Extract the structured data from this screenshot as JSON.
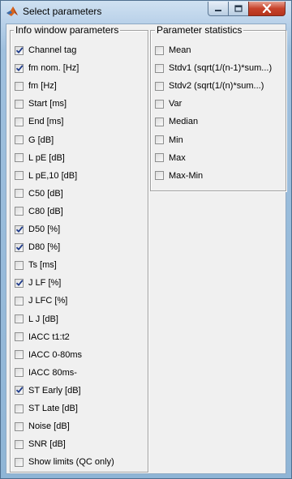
{
  "window": {
    "title": "Select parameters",
    "accent_close": "#c7432b"
  },
  "icons": {
    "app": "matlab-logo-icon",
    "minimize": "minimize-icon",
    "maximize": "maximize-icon",
    "close": "close-icon"
  },
  "info_panel": {
    "legend": "Info window parameters",
    "items": [
      {
        "label": "Channel tag",
        "checked": true
      },
      {
        "label": "fm nom. [Hz]",
        "checked": true
      },
      {
        "label": "fm [Hz]",
        "checked": false
      },
      {
        "label": "Start [ms]",
        "checked": false
      },
      {
        "label": "End [ms]",
        "checked": false
      },
      {
        "label": "G [dB]",
        "checked": false
      },
      {
        "label": "L pE [dB]",
        "checked": false
      },
      {
        "label": "L pE,10 [dB]",
        "checked": false
      },
      {
        "label": "C50 [dB]",
        "checked": false
      },
      {
        "label": "C80 [dB]",
        "checked": false
      },
      {
        "label": "D50 [%]",
        "checked": true
      },
      {
        "label": "D80 [%]",
        "checked": true
      },
      {
        "label": "Ts [ms]",
        "checked": false
      },
      {
        "label": "J LF [%]",
        "checked": true
      },
      {
        "label": "J LFC [%]",
        "checked": false
      },
      {
        "label": "L J [dB]",
        "checked": false
      },
      {
        "label": "IACC t1:t2",
        "checked": false
      },
      {
        "label": "IACC 0-80ms",
        "checked": false
      },
      {
        "label": "IACC 80ms-",
        "checked": false
      },
      {
        "label": "ST Early [dB]",
        "checked": true
      },
      {
        "label": "ST Late [dB]",
        "checked": false
      },
      {
        "label": "Noise [dB]",
        "checked": false
      },
      {
        "label": "SNR [dB]",
        "checked": false
      },
      {
        "label": "Show limits (QC only)",
        "checked": false
      }
    ]
  },
  "stats_panel": {
    "legend": "Parameter statistics",
    "items": [
      {
        "label": "Mean",
        "checked": false
      },
      {
        "label": "Stdv1 (sqrt(1/(n-1)*sum...)",
        "checked": false
      },
      {
        "label": "Stdv2 (sqrt(1/(n)*sum...)",
        "checked": false
      },
      {
        "label": "Var",
        "checked": false
      },
      {
        "label": "Median",
        "checked": false
      },
      {
        "label": "Min",
        "checked": false
      },
      {
        "label": "Max",
        "checked": false
      },
      {
        "label": "Max-Min",
        "checked": false
      }
    ]
  }
}
